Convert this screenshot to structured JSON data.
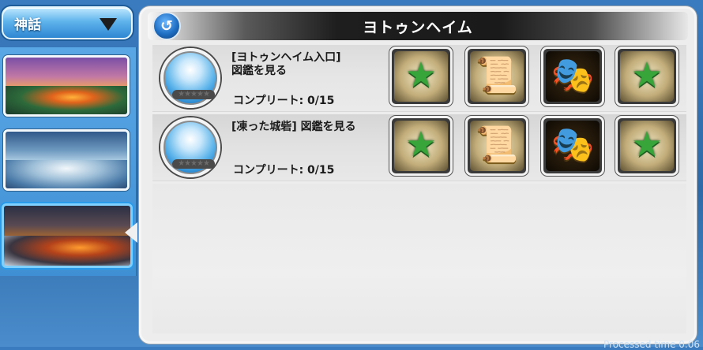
{
  "dropdown": {
    "label": "神話",
    "icon": "chevron-down-icon"
  },
  "sidebar": {
    "thumbnails": [
      {
        "name": "world-thumbnail-1"
      },
      {
        "name": "world-thumbnail-2"
      },
      {
        "name": "world-thumbnail-3",
        "selected": true
      }
    ]
  },
  "panel": {
    "title": "ヨトゥンヘイム",
    "back_icon": "↺",
    "rows": [
      {
        "title": "[ヨトゥンヘイム入口]\n図鑑を見る",
        "progress": "コンプリート: 0/15",
        "stars_filled": 0,
        "stars_total": 5,
        "rewards": [
          "star-stack-icon",
          "scroll-icon",
          "mask-icon",
          "star-stack-icon"
        ]
      },
      {
        "title": "[凍った城砦] 図鑑を見る",
        "progress": "コンプリート: 0/15",
        "stars_filled": 0,
        "stars_total": 5,
        "rewards": [
          "star-stack-icon",
          "scroll-icon",
          "mask-icon",
          "star-stack-icon"
        ]
      }
    ]
  },
  "footer": {
    "text": "Processed time 0.06"
  },
  "colors": {
    "accent": "#2e86d2",
    "panel_bg": "#ededed",
    "title_bar": "#1e1e1e"
  }
}
